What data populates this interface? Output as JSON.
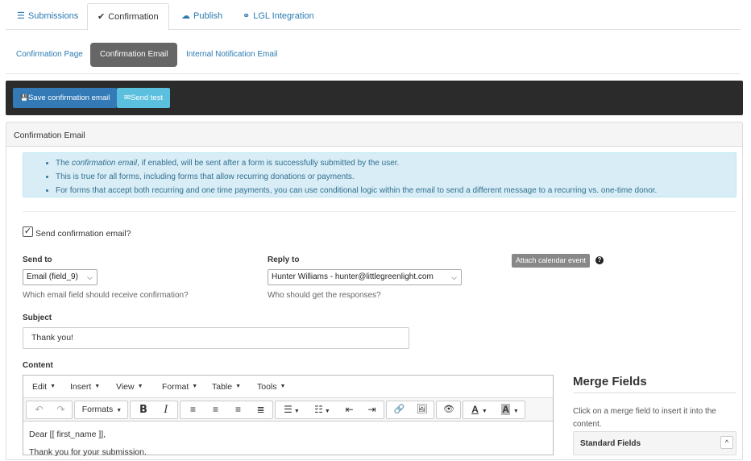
{
  "top_tabs": [
    {
      "label": "Submissions",
      "icon": "list-icon",
      "glyph": "☰"
    },
    {
      "label": "Confirmation",
      "icon": "check-icon",
      "glyph": "✔"
    },
    {
      "label": "Publish",
      "icon": "cloud-icon",
      "glyph": "☁"
    },
    {
      "label": "LGL Integration",
      "icon": "link-icon",
      "glyph": "⚭"
    }
  ],
  "sub_tabs": [
    "Confirmation Page",
    "Confirmation Email",
    "Internal Notification Email"
  ],
  "toolbar": {
    "save_label": "Save confirmation email",
    "save_glyph": "💾",
    "send_label": "Send test",
    "send_glyph": "✉"
  },
  "panel": {
    "title": "Confirmation Email",
    "info": {
      "line1_pre": "The ",
      "line1_em": "confirmation email",
      "line1_post": ", if enabled, will be sent after a form is successfully submitted by the user.",
      "line2": "This is true for all forms, including forms that allow recurring donations or payments.",
      "line3": "For forms that accept both recurring and one time payments, you can use conditional logic within the email to send a different message to a recurring vs. one-time donor."
    },
    "send_checkbox": {
      "label": "Send confirmation email?",
      "checked": true,
      "mark": "✓"
    },
    "send_to": {
      "label": "Send to",
      "value": "Email (field_9)",
      "help": "Which email field should receive confirmation?"
    },
    "reply_to": {
      "label": "Reply to",
      "value": "Hunter Williams - hunter@littlegreenlight.com",
      "help": "Who should get the responses?"
    },
    "attach_calendar": "Attach calendar event",
    "help_glyph": "?",
    "subject": {
      "label": "Subject",
      "value": "Thank you!"
    },
    "content": {
      "label": "Content",
      "menus": [
        "Edit",
        "Insert",
        "View",
        "Format",
        "Table",
        "Tools"
      ],
      "formats_label": "Formats",
      "body_lines": [
        "Dear [[ first_name ]],",
        "Thank you for your submission."
      ]
    }
  },
  "merge_fields": {
    "title": "Merge Fields",
    "help": "Click on a merge field to insert it into the content.",
    "group": "Standard Fields",
    "group_glyph": "^"
  },
  "glyphs": {
    "caret": "▼",
    "chevron": "⌵",
    "undo": "↶",
    "redo": "↷",
    "bold": "B",
    "italic": "I",
    "align_left": "≡",
    "align_center": "≡",
    "align_right": "≡",
    "justify": "≣",
    "bullets": "☰",
    "numbers": "☷",
    "outdent": "⇤",
    "indent": "⇥",
    "link": "🔗",
    "image": "🖼",
    "preview": "👁",
    "text_color": "A",
    "bg_color": "A"
  },
  "colors": {
    "primary": "#337ab7",
    "info": "#5bc0de",
    "toolbar_bg": "#2b2b2b",
    "active_subtab": "#666666"
  }
}
